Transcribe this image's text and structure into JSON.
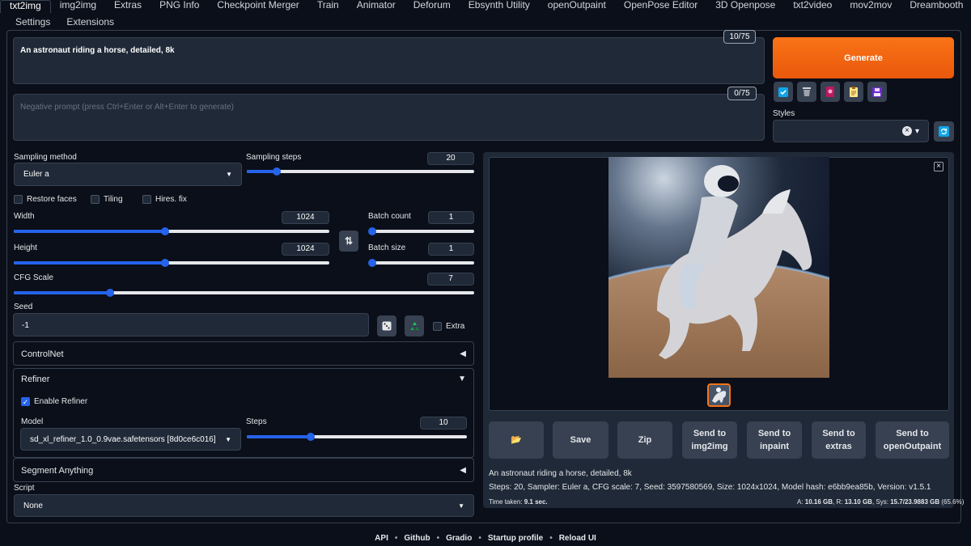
{
  "tabs": [
    "txt2img",
    "img2img",
    "Extras",
    "PNG Info",
    "Checkpoint Merger",
    "Train",
    "Animator",
    "Deforum",
    "Ebsynth Utility",
    "openOutpaint",
    "OpenPose Editor",
    "3D Openpose",
    "txt2video",
    "mov2mov",
    "Dreambooth"
  ],
  "tabs2": [
    "Settings",
    "Extensions"
  ],
  "prompt": {
    "value": "An astronaut riding a horse, detailed, 8k",
    "counter": "10/75"
  },
  "negative_prompt": {
    "placeholder": "Negative prompt (press Ctrl+Enter or Alt+Enter to generate)",
    "counter": "0/75"
  },
  "generate_label": "Generate",
  "tool_icons": [
    "check-square-icon",
    "trash-icon",
    "pink-card-icon",
    "clipboard-icon",
    "save-disk-icon"
  ],
  "styles": {
    "label": "Styles",
    "clear": "×",
    "caret": "▾",
    "refresh_icon": "refresh-icon"
  },
  "sampling": {
    "method_label": "Sampling method",
    "method_value": "Euler a",
    "steps_label": "Sampling steps",
    "steps_value": "20",
    "steps_frac": 0.13
  },
  "checkboxes": {
    "restore_faces": "Restore faces",
    "tiling": "Tiling",
    "hires": "Hires. fix"
  },
  "width": {
    "label": "Width",
    "value": "1024",
    "frac": 0.48
  },
  "height": {
    "label": "Height",
    "value": "1024",
    "frac": 0.48
  },
  "swap_icon": "⇅",
  "batch_count": {
    "label": "Batch count",
    "value": "1",
    "frac": 0.0
  },
  "batch_size": {
    "label": "Batch size",
    "value": "1",
    "frac": 0.0
  },
  "cfg": {
    "label": "CFG Scale",
    "value": "7",
    "frac": 0.21
  },
  "seed": {
    "label": "Seed",
    "value": "-1",
    "extra_label": "Extra"
  },
  "controlnet": {
    "title": "ControlNet",
    "arrow": "◀"
  },
  "refiner": {
    "title": "Refiner",
    "arrow": "▼",
    "enable_label": "Enable Refiner",
    "enable_check": "✓",
    "model_label": "Model",
    "model_value": "sd_xl_refiner_1.0_0.9vae.safetensors [8d0ce6c016]",
    "steps_label": "Steps",
    "steps_value": "10",
    "steps_frac": 0.29
  },
  "segment": {
    "title": "Segment Anything",
    "arrow": "◀"
  },
  "script": {
    "label": "Script",
    "value": "None"
  },
  "output": {
    "close": "×"
  },
  "out_buttons": [
    {
      "name": "open-folder-button",
      "label": "📂"
    },
    {
      "name": "save-button",
      "label": "Save"
    },
    {
      "name": "zip-button",
      "label": "Zip"
    },
    {
      "name": "send-img2img-button",
      "label": "Send to\nimg2img"
    },
    {
      "name": "send-inpaint-button",
      "label": "Send to\ninpaint"
    },
    {
      "name": "send-extras-button",
      "label": "Send to\nextras"
    },
    {
      "name": "send-openoutpaint-button",
      "label": "Send to\nopenOutpaint"
    }
  ],
  "info": {
    "prompt": "An astronaut riding a horse, detailed, 8k",
    "params": "Steps: 20, Sampler: Euler a, CFG scale: 7, Seed: 3597580569, Size: 1024x1024, Model hash: e6bb9ea85b, Version: v1.5.1",
    "time_label": "Time taken: ",
    "time_value": "9.1 sec.",
    "mem_a_label": "A: ",
    "mem_a": "10.16 GB",
    "mem_r_label": ", R: ",
    "mem_r": "13.10 GB",
    "mem_sys_label": ", Sys: ",
    "mem_sys": "15.7/23.9883 GB",
    "mem_pct": " (65.6%)"
  },
  "footer": [
    "API",
    "Github",
    "Gradio",
    "Startup profile",
    "Reload UI"
  ],
  "footer_sep": "•"
}
